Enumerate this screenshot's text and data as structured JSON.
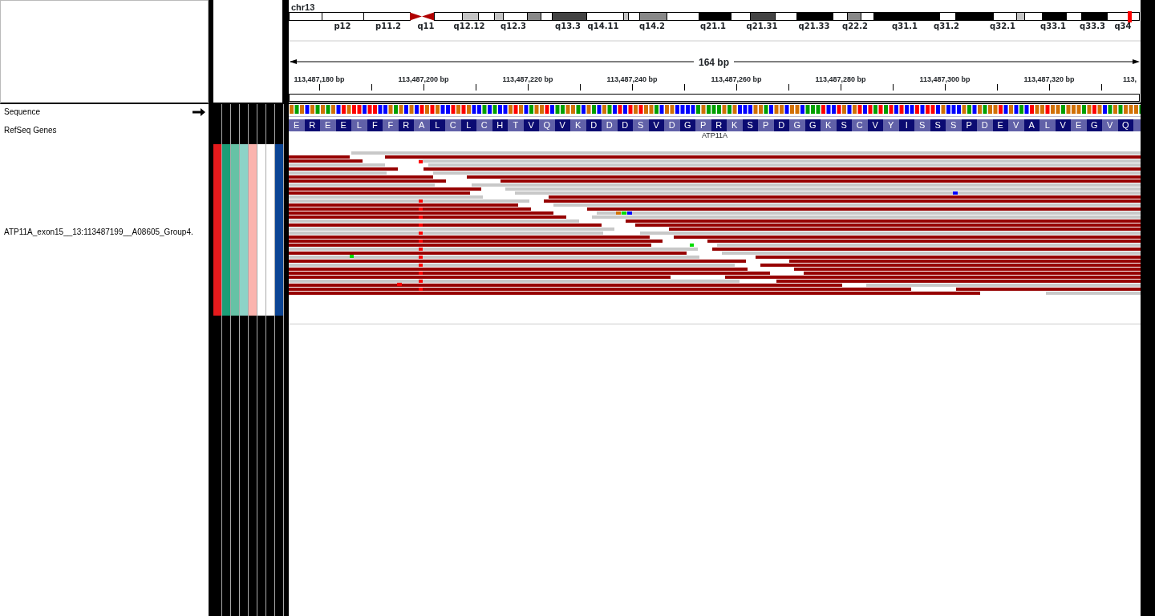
{
  "tracks": [
    {
      "name": "Sequence",
      "kind": "sequence"
    },
    {
      "name": "RefSeq Genes",
      "kind": "genes"
    },
    {
      "name": "ATP11A_exon15__13:113487199__A08605_Group4.",
      "kind": "alignment"
    }
  ],
  "attributes": [
    {
      "color": "#e41a1c"
    },
    {
      "color": "#1b9e77"
    },
    {
      "color": "#66c2a5"
    },
    {
      "color": "#8dd3c7"
    },
    {
      "color": "#fbb4ae"
    },
    {
      "color": "#ffffff"
    },
    {
      "color": "#ffffff"
    },
    {
      "color": "#0c4595"
    }
  ],
  "ideogram": {
    "chromosome": "chr13",
    "band_labels": [
      "p12",
      "p11.2",
      "q11",
      "q12.12",
      "q12.3",
      "q13.3",
      "q14.11",
      "q14.2",
      "q21.1",
      "q21.31",
      "q21.33",
      "q22.2",
      "q31.1",
      "q31.2",
      "q32.1",
      "q33.1",
      "q33.3",
      "q34"
    ]
  },
  "ruler": {
    "span": "164 bp",
    "tick_labels": [
      "113,487,180 bp",
      "113,487,200 bp",
      "113,487,220 bp",
      "113,487,240 bp",
      "113,487,260 bp",
      "113,487,280 bp",
      "113,487,300 bp",
      "113,487,320 bp",
      "113,"
    ]
  },
  "gene_track": {
    "amino_acids": [
      "E",
      "R",
      "E",
      "E",
      "L",
      "F",
      "F",
      "R",
      "A",
      "L",
      "C",
      "L",
      "C",
      "H",
      "T",
      "V",
      "Q",
      "V",
      "K",
      "D",
      "D",
      "D",
      "S",
      "V",
      "D",
      "G",
      "P",
      "R",
      "K",
      "S",
      "P",
      "D",
      "G",
      "G",
      "K",
      "S",
      "C",
      "V",
      "Y",
      "I",
      "S",
      "S",
      "S",
      "P",
      "D",
      "E",
      "V",
      "A",
      "L",
      "V",
      "E",
      "G",
      "V",
      "Q"
    ],
    "gene": "ATP11A"
  }
}
